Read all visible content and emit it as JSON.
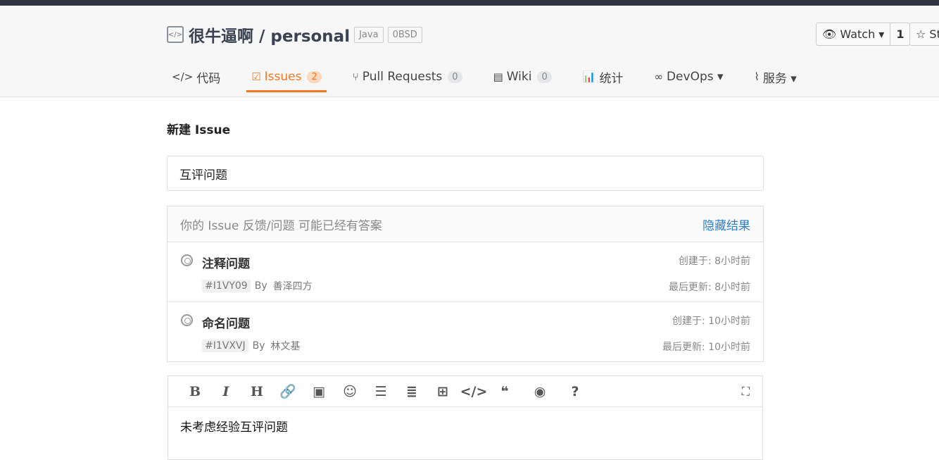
{
  "repo": {
    "icon": "code-repo-icon",
    "title": "很牛逼啊 / personal",
    "tags": [
      "Java",
      "0BSD"
    ]
  },
  "watch": {
    "label": "Watch ▾",
    "count": "1",
    "star_label": "☆ St"
  },
  "tabs": [
    {
      "icon": "</>",
      "label": "代码"
    },
    {
      "icon": "☑",
      "label": "Issues",
      "badge": "2",
      "active": true
    },
    {
      "icon": "⑂",
      "label": "Pull Requests",
      "badge": "0"
    },
    {
      "icon": "▤",
      "label": "Wiki",
      "badge": "0"
    },
    {
      "icon": "📊",
      "label": "统计"
    },
    {
      "icon": "∞",
      "label": "DevOps ▾"
    },
    {
      "icon": "⌇",
      "label": "服务 ▾"
    }
  ],
  "page_title": "新建 Issue",
  "title_value": "互评问题",
  "suggestions": {
    "header": "你的 Issue 反馈/问题 可能已经有答案",
    "hide": "隐藏结果",
    "items": [
      {
        "title": "注释问题",
        "id": "#I1VY09",
        "by": "By",
        "author": "善泽四方",
        "created": "创建于:  8小时前",
        "updated": "最后更新:  8小时前"
      },
      {
        "title": "命名问题",
        "id": "#I1VXVJ",
        "by": "By",
        "author": "林文基",
        "created": "创建于:  10小时前",
        "updated": "最后更新:  10小时前"
      }
    ]
  },
  "editor": {
    "tools": [
      {
        "name": "bold",
        "glyph": "B"
      },
      {
        "name": "italic",
        "glyph": "I"
      },
      {
        "name": "heading",
        "glyph": "H"
      },
      {
        "name": "link",
        "glyph": "🔗"
      },
      {
        "name": "image",
        "glyph": "▣"
      },
      {
        "name": "emoji",
        "glyph": "☺"
      },
      {
        "name": "bullet-list",
        "glyph": "☰"
      },
      {
        "name": "numbered-list",
        "glyph": "≣"
      },
      {
        "name": "table",
        "glyph": "⊞"
      },
      {
        "name": "code",
        "glyph": "</>"
      },
      {
        "name": "quote",
        "glyph": "❝"
      },
      {
        "name": "preview",
        "glyph": "◉"
      },
      {
        "name": "help",
        "glyph": "?"
      }
    ],
    "fullscreen": "⛶",
    "content": "未考虑经验互评问题"
  }
}
